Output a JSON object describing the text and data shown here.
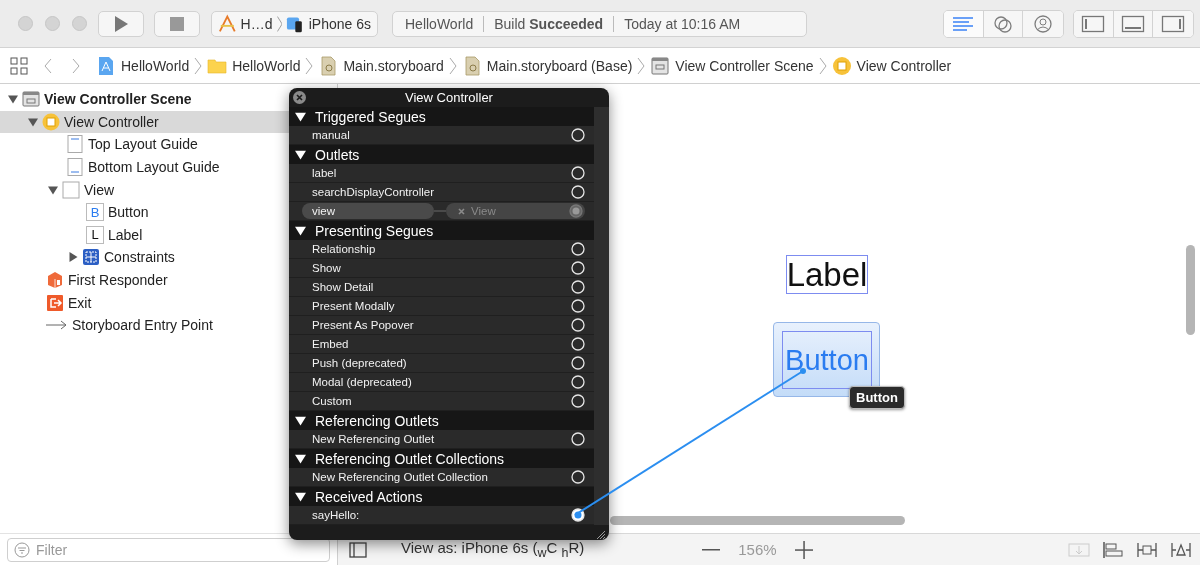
{
  "toolbar": {
    "scheme": {
      "target": "H…d",
      "device": "iPhone 6s"
    },
    "status": {
      "project": "HelloWorld",
      "build": "Build **Succeeded**",
      "time": "Today at 10:16 AM"
    },
    "editor_modes": [
      {
        "kind": "standard",
        "selected": true
      },
      {
        "kind": "assistant",
        "selected": false
      },
      {
        "kind": "version",
        "selected": false
      }
    ],
    "panels": [
      {
        "kind": "navigator"
      },
      {
        "kind": "debug"
      },
      {
        "kind": "utilities"
      }
    ]
  },
  "breadcrumb": [
    {
      "label": "HelloWorld",
      "kind": "project"
    },
    {
      "label": "HelloWorld",
      "kind": "folder"
    },
    {
      "label": "Main.storyboard",
      "kind": "storyboard"
    },
    {
      "label": "Main.storyboard (Base)",
      "kind": "storyboard"
    },
    {
      "label": "View Controller Scene",
      "kind": "scene"
    },
    {
      "label": "View Controller",
      "kind": "controller"
    }
  ],
  "navigator": {
    "tree": [
      {
        "label": "View Controller Scene",
        "kind": "scene",
        "expanded": true,
        "selected": false,
        "children": [
          {
            "label": "View Controller",
            "kind": "controller",
            "expanded": true,
            "selected": true,
            "children": [
              {
                "label": "Top Layout Guide",
                "kind": "top-guide",
                "selected": false
              },
              {
                "label": "Bottom Layout Guide",
                "kind": "bottom-guide",
                "selected": false
              },
              {
                "label": "View",
                "kind": "view",
                "expanded": true,
                "selected": false,
                "children": [
                  {
                    "label": "Button",
                    "kind": "letter",
                    "glyph": "B",
                    "selected": false
                  },
                  {
                    "label": "Label",
                    "kind": "letter",
                    "glyph": "L",
                    "selected": false
                  },
                  {
                    "label": "Constraints",
                    "kind": "constraints",
                    "expanded": false,
                    "selected": false
                  }
                ]
              }
            ]
          },
          {
            "label": "First Responder",
            "kind": "responder",
            "selected": false
          },
          {
            "label": "Exit",
            "kind": "exit",
            "selected": false
          },
          {
            "label": "Storyboard Entry Point",
            "kind": "entry",
            "selected": false
          }
        ]
      }
    ],
    "filter": {
      "placeholder": "Filter"
    }
  },
  "canvas": {
    "label": "Label",
    "button": "Button",
    "tooltip": "Button",
    "view_as": "View as: iPhone 6s ($_{w}$C $_{h}$R)",
    "zoom": "156%"
  },
  "connections_popup": {
    "title": "View Controller",
    "sections": [
      {
        "title": "Triggered Segues",
        "expanded": true,
        "items": [
          {
            "name": "manual",
            "connected": false
          }
        ]
      },
      {
        "title": "Outlets",
        "expanded": true,
        "items": [
          {
            "name": "label",
            "connected": false
          },
          {
            "name": "searchDisplayController",
            "connected": false
          },
          {
            "name": "view",
            "connected": true,
            "target": "View"
          }
        ]
      },
      {
        "title": "Presenting Segues",
        "expanded": true,
        "items": [
          {
            "name": "Relationship",
            "connected": false
          },
          {
            "name": "Show",
            "connected": false
          },
          {
            "name": "Show Detail",
            "connected": false
          },
          {
            "name": "Present Modally",
            "connected": false
          },
          {
            "name": "Present As Popover",
            "connected": false
          },
          {
            "name": "Embed",
            "connected": false
          },
          {
            "name": "Push (deprecated)",
            "connected": false
          },
          {
            "name": "Modal (deprecated)",
            "connected": false
          },
          {
            "name": "Custom",
            "connected": false
          }
        ]
      },
      {
        "title": "Referencing Outlets",
        "expanded": true,
        "items": [
          {
            "name": "New Referencing Outlet",
            "connected": false
          }
        ]
      },
      {
        "title": "Referencing Outlet Collections",
        "expanded": true,
        "items": [
          {
            "name": "New Referencing Outlet Collection",
            "connected": false
          }
        ]
      },
      {
        "title": "Received Actions",
        "expanded": true,
        "items": [
          {
            "name": "sayHello:",
            "connected": true
          }
        ]
      }
    ]
  }
}
